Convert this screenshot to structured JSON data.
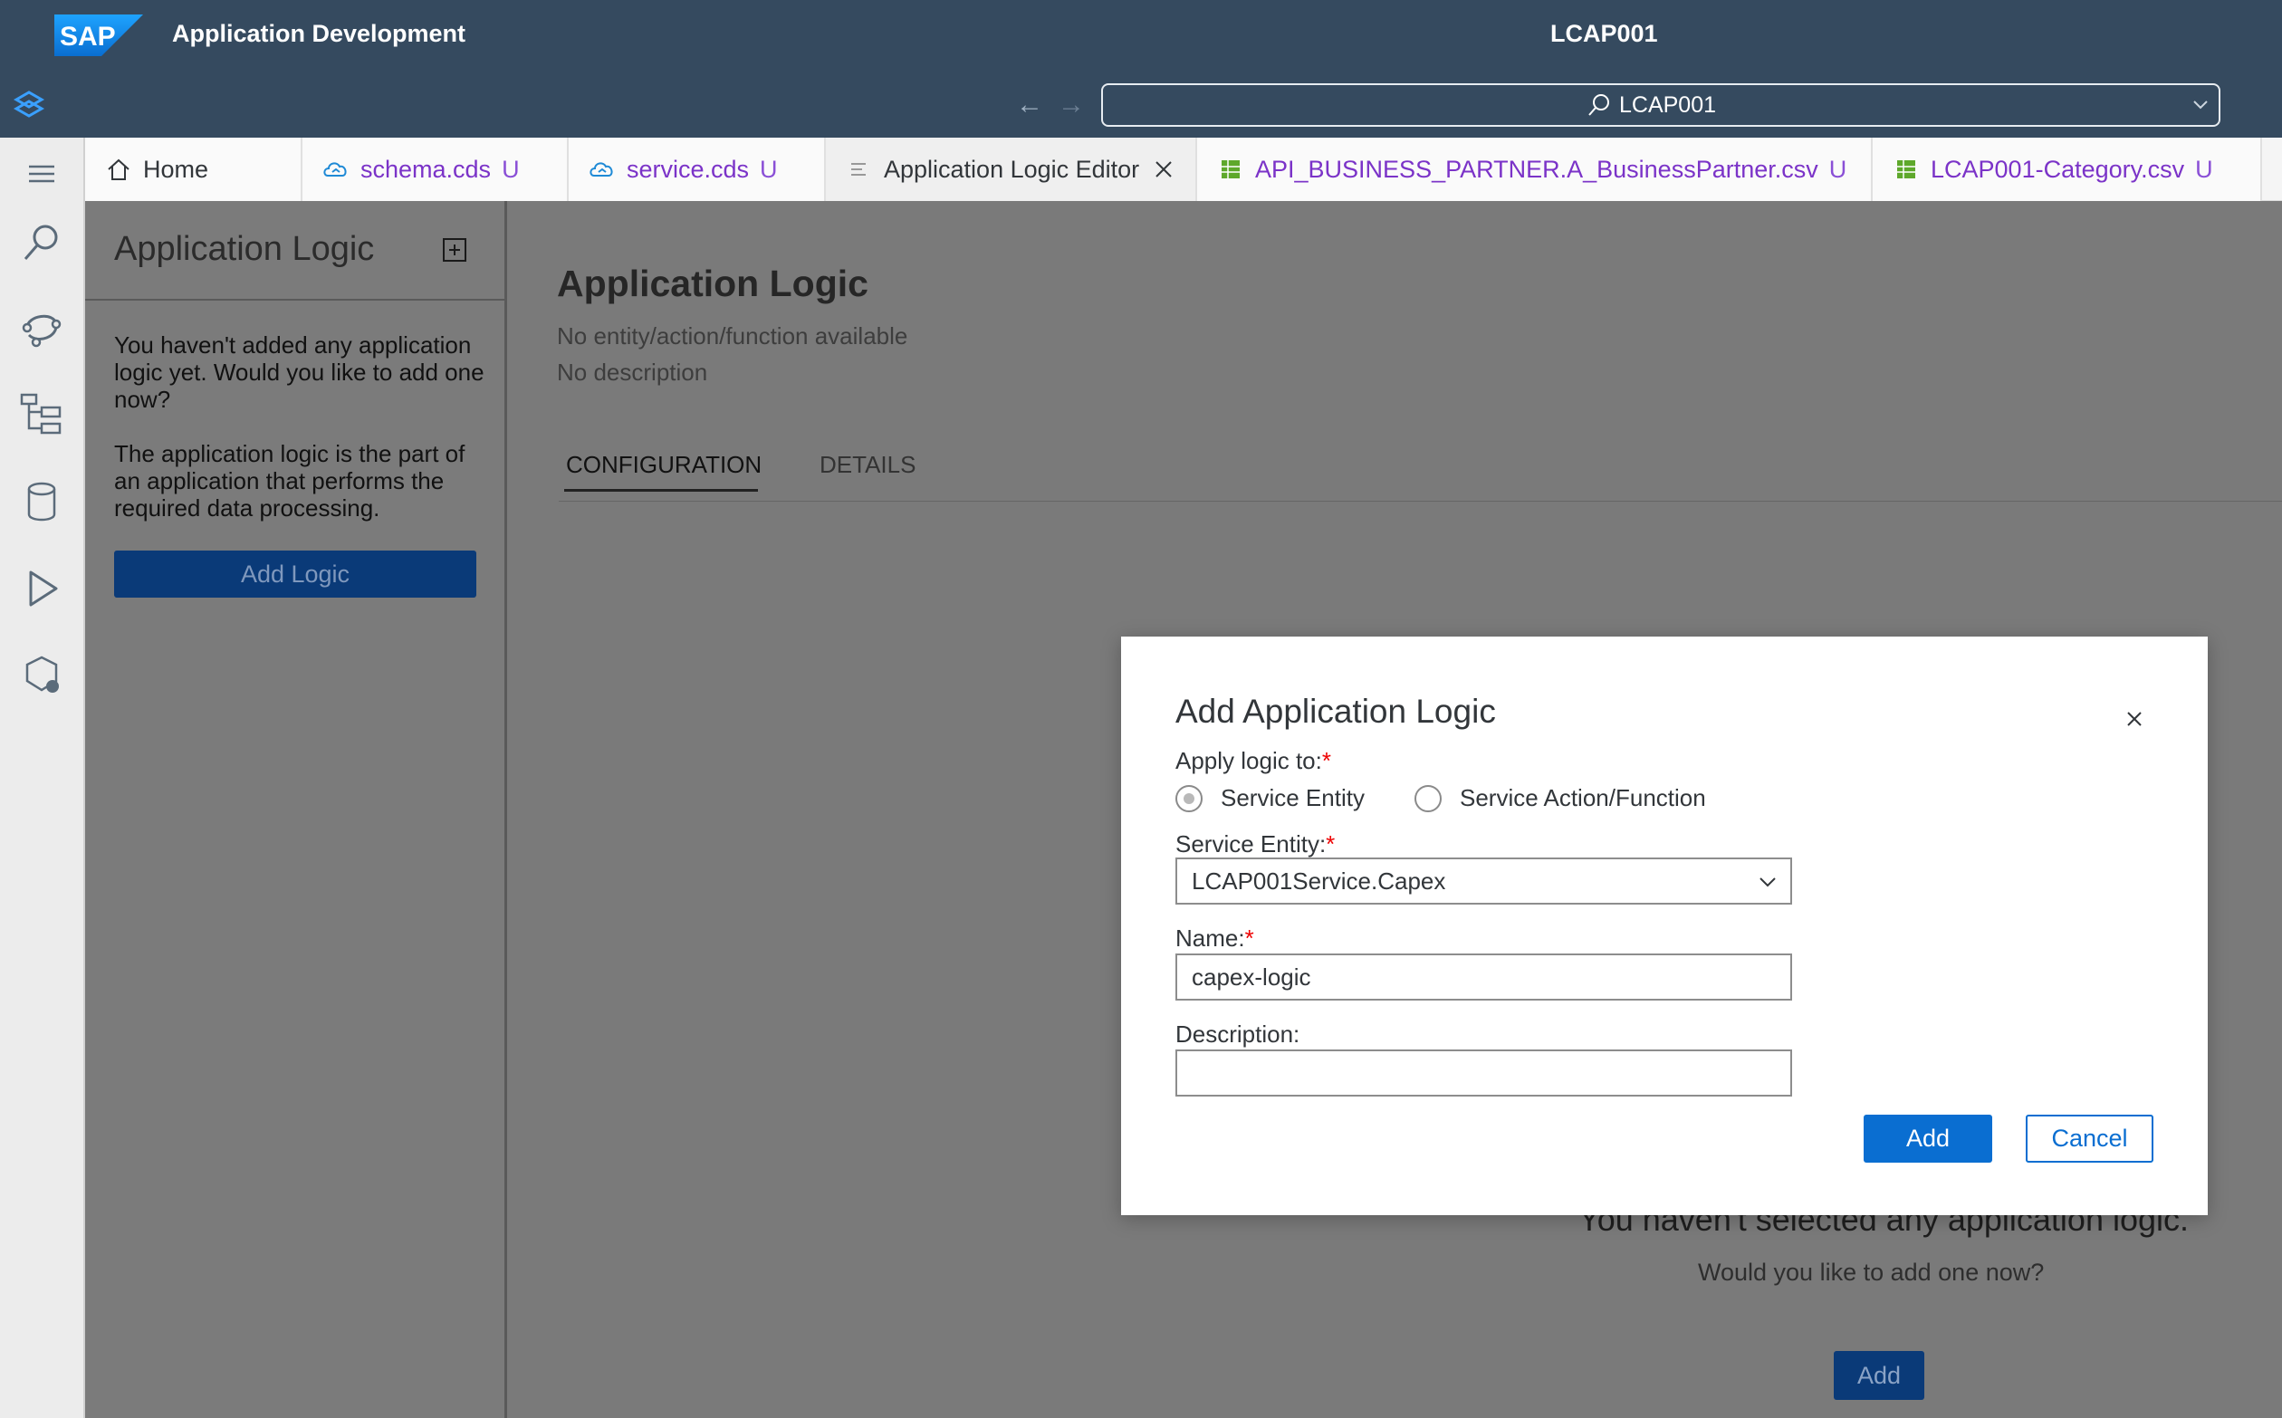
{
  "shell": {
    "brand_logo_text": "SAP",
    "app_title": "Application Development",
    "project_title": "LCAP001",
    "command_box_value": "LCAP001"
  },
  "tabs": [
    {
      "label": "Home",
      "status": "",
      "icon": "home-icon"
    },
    {
      "label": "schema.cds",
      "status": "U",
      "icon": "cds-file-icon"
    },
    {
      "label": "service.cds",
      "status": "U",
      "icon": "cds-file-icon"
    },
    {
      "label": "Application Logic Editor",
      "status": "",
      "icon": "editor-icon"
    },
    {
      "label": "API_BUSINESS_PARTNER.A_BusinessPartner.csv",
      "status": "U",
      "icon": "csv-file-icon"
    },
    {
      "label": "LCAP001-Category.csv",
      "status": "U",
      "icon": "csv-file-icon"
    }
  ],
  "left_panel": {
    "title": "Application Logic",
    "empty_text": "You haven't added any application logic yet. Would you like to add one now?",
    "info_text": "The application logic is the part of an application that performs the required data processing.",
    "add_button": "Add Logic"
  },
  "editor": {
    "title": "Application Logic",
    "entity_text": "No entity/action/function available",
    "description_text": "No description",
    "tabs": [
      "CONFIGURATION",
      "DETAILS"
    ],
    "empty_heading": "You haven't selected any application logic.",
    "empty_subtext": "Would you like to add one now?",
    "add_button": "Add"
  },
  "dialog": {
    "title": "Add Application Logic",
    "apply_label": "Apply logic to:",
    "radio_options": [
      "Service Entity",
      "Service Action/Function"
    ],
    "selected_option": "Service Entity",
    "entity_label": "Service Entity:",
    "entity_value": "LCAP001Service.Capex",
    "name_label": "Name:",
    "name_value": "capex-logic",
    "description_label": "Description:",
    "description_value": "",
    "required_marker": "*",
    "add_button": "Add",
    "cancel_button": "Cancel"
  },
  "colors": {
    "shell_bg": "#354a5f",
    "primary": "#0a6ed1",
    "modified_tab": "#7b33c8",
    "required": "#e00000"
  }
}
